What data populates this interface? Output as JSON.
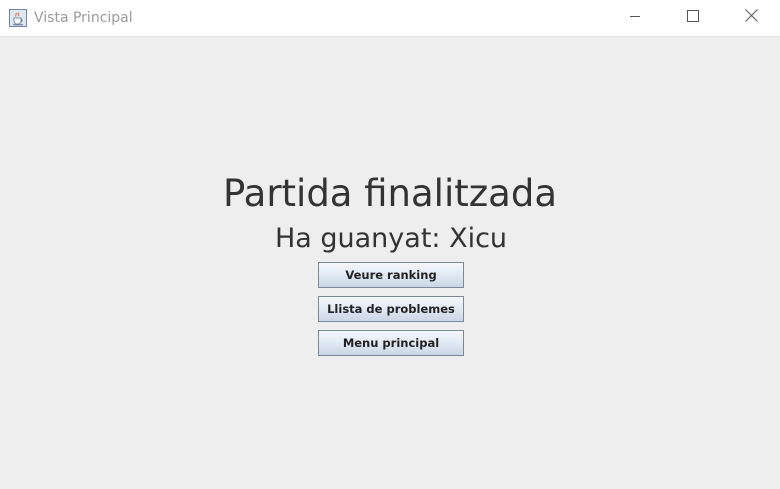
{
  "window": {
    "title": "Vista Principal",
    "icon": "java-cup-icon",
    "controls": {
      "minimize_icon": "minimize-icon",
      "maximize_icon": "maximize-icon",
      "close_icon": "close-icon"
    }
  },
  "main": {
    "heading": "Partida finalitzada",
    "winner_text": "Ha guanyat: Xicu",
    "buttons": {
      "ranking": "Veure ranking",
      "problems": "Llista de problemes",
      "main_menu": "Menu principal"
    }
  },
  "colors": {
    "background": "#eeeeee",
    "titlebar": "#ffffff",
    "text": "#333333",
    "button_border": "#7a8a99"
  }
}
